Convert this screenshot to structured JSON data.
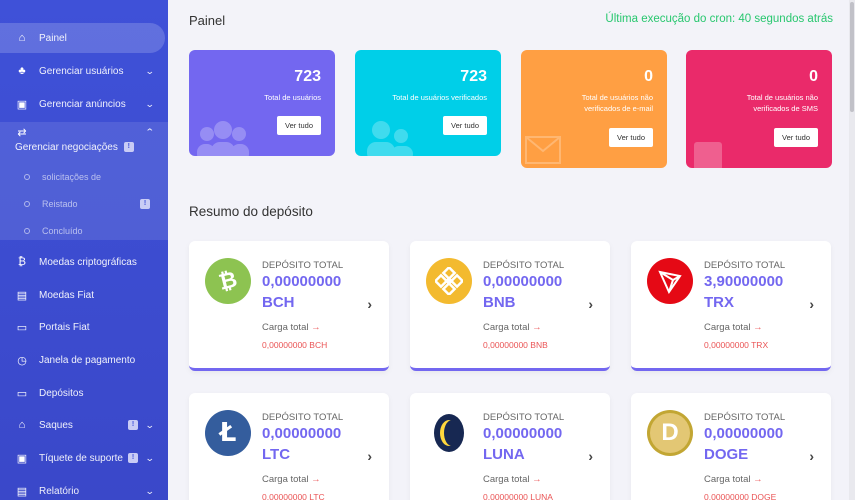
{
  "sidebar": {
    "items": [
      {
        "label": "Painel",
        "icon": "home-icon",
        "glyph": "⌂"
      },
      {
        "label": "Gerenciar usuários",
        "icon": "users-icon",
        "glyph": "♣"
      },
      {
        "label": "Gerenciar anúncios",
        "icon": "ads-icon",
        "glyph": "▣"
      },
      {
        "label": "Gerenciar negociações",
        "icon": "exchange-icon",
        "glyph": "⇄",
        "badge": "!"
      },
      {
        "label": "Moedas criptográficas",
        "icon": "bitcoin-icon",
        "glyph": "₿"
      },
      {
        "label": "Moedas Fiat",
        "icon": "money-icon",
        "glyph": "▤"
      },
      {
        "label": "Portais Fiat",
        "icon": "wallet-icon",
        "glyph": "▭"
      },
      {
        "label": "Janela de pagamento",
        "icon": "clock-icon",
        "glyph": "◷"
      },
      {
        "label": "Depósitos",
        "icon": "card-icon",
        "glyph": "▭"
      },
      {
        "label": "Saques",
        "icon": "bank-icon",
        "glyph": "⌂",
        "badge": "!"
      },
      {
        "label": "Tíquete de suporte",
        "icon": "ticket-icon",
        "glyph": "▣",
        "badge": "!"
      },
      {
        "label": "Relatório",
        "icon": "report-icon",
        "glyph": "▤"
      }
    ],
    "subitems": [
      {
        "label": "solicitações de"
      },
      {
        "label": "Reistado",
        "badge": "!"
      },
      {
        "label": "Concluído"
      }
    ]
  },
  "header": {
    "title": "Painel",
    "cron": "Última execução do cron: 40 segundos atrás"
  },
  "stats": [
    {
      "value": "723",
      "label": "Total de usuários",
      "button": "Ver tudo",
      "color": "#7367f0"
    },
    {
      "value": "723",
      "label": "Total de usuários verificados",
      "button": "Ver tudo",
      "color": "#00cfe8"
    },
    {
      "value": "0",
      "label": "Total de usuários não verificados de e-mail",
      "button": "Ver tudo",
      "color": "#ff9f43"
    },
    {
      "value": "0",
      "label": "Total de usuários não verificados de SMS",
      "button": "Ver tudo",
      "color": "#ea2a6a"
    }
  ],
  "deposit_section": {
    "title": "Resumo do depósito",
    "label": "DEPÓSITO TOTAL",
    "charge_label": "Carga total",
    "cards": [
      {
        "amount": "0,00000000",
        "symbol": "BCH",
        "charge": "0,00000000 BCH",
        "icon": "bitcoin-cash-icon",
        "coin_color": "#8dc351"
      },
      {
        "amount": "0,00000000",
        "symbol": "BNB",
        "charge": "0,00000000 BNB",
        "icon": "binance-icon",
        "coin_color": "#f3ba2f"
      },
      {
        "amount": "3,90000000",
        "symbol": "TRX",
        "charge": "0,00000000 TRX",
        "icon": "tron-icon",
        "coin_color": "#e50915"
      },
      {
        "amount": "0,00000000",
        "symbol": "LTC",
        "charge": "0,00000000 LTC",
        "icon": "litecoin-icon",
        "coin_color": "#345d9d"
      },
      {
        "amount": "0,00000000",
        "symbol": "LUNA",
        "charge": "0,00000000 LUNA",
        "icon": "luna-icon",
        "coin_color": "#172852"
      },
      {
        "amount": "0,00000000",
        "symbol": "DOGE",
        "charge": "0,00000000 DOGE",
        "icon": "dogecoin-icon",
        "coin_color": "#c2a633"
      }
    ]
  }
}
